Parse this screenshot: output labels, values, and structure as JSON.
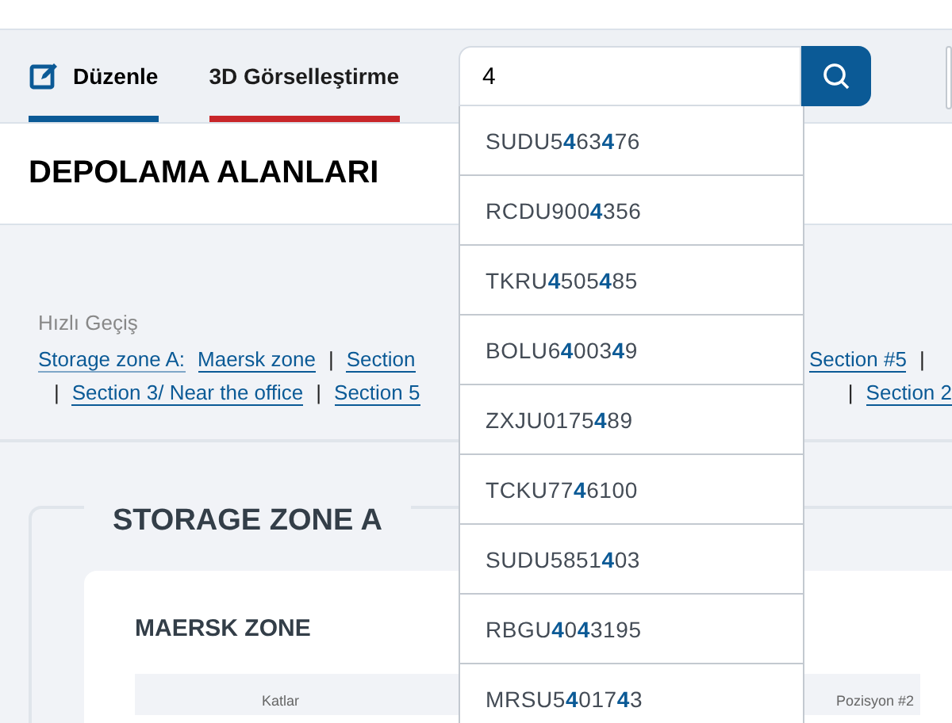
{
  "tabs": [
    {
      "label": "Düzenle",
      "icon": true,
      "selected": true,
      "color": "#0b5a96"
    },
    {
      "label": "3D Görselleştirme",
      "icon": false,
      "selected": false,
      "color": "#c8262a"
    }
  ],
  "search": {
    "value": "4",
    "suggestions": [
      "SUDU5**4**63**4**76",
      "RCDU900**4**356",
      "TKRU**4**505**4**85",
      "BOLU6**4**003**4**9",
      "ZXJU0175**4**89",
      "TCKU77**4**6100",
      "SUDU5851**4**03",
      "RBGU**4**0**4**3195",
      "MRSU5**4**017**4**3"
    ]
  },
  "page_title": "DEPOLAMA ALANLARI",
  "quick_nav": {
    "label": "Hızlı Geçiş",
    "row_1_left": [
      {
        "kind": "zone",
        "text": "Storage zone A:"
      },
      {
        "kind": "link",
        "text": "Maersk zone"
      },
      {
        "kind": "sep",
        "text": "|"
      },
      {
        "kind": "link",
        "text": "Section"
      }
    ],
    "row_1_right": [
      {
        "kind": "link",
        "text": "Section #5"
      },
      {
        "kind": "sep",
        "text": "|"
      }
    ],
    "row_2_left": [
      {
        "kind": "sep",
        "text": "|"
      },
      {
        "kind": "link",
        "text": "Section 3/ Near the office"
      },
      {
        "kind": "sep",
        "text": "|"
      },
      {
        "kind": "link",
        "text": "Section 5"
      }
    ],
    "row_2_right": [
      {
        "kind": "sep",
        "text": "|"
      },
      {
        "kind": "link",
        "text": "Section 2"
      }
    ]
  },
  "zone": {
    "title": "STORAGE ZONE A",
    "card_title": "MAERSK ZONE",
    "columns": [
      "Katlar",
      "Pozisyon #2"
    ]
  }
}
